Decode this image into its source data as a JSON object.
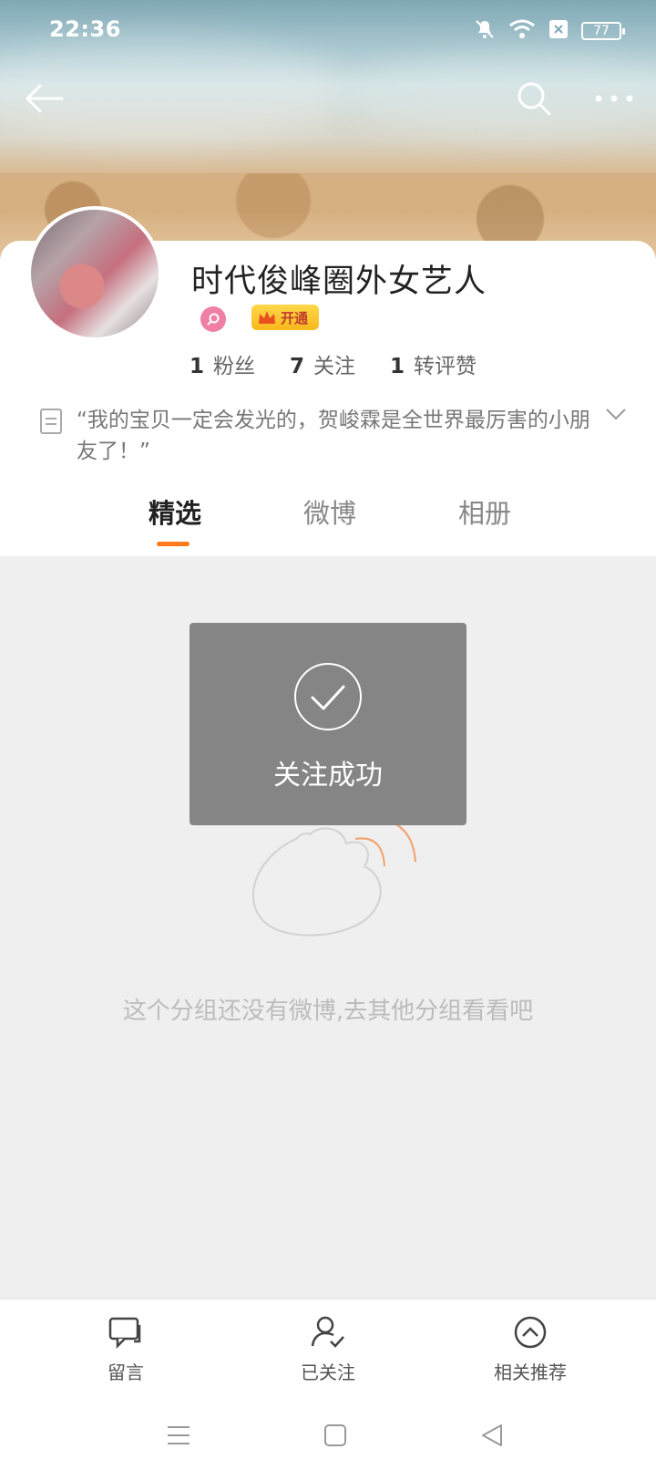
{
  "status_bar": {
    "time": "22:36",
    "battery": "77"
  },
  "profile": {
    "name": "时代俊峰圈外女艺人",
    "vip_label": "开通",
    "stats": [
      {
        "count": "1",
        "label": "粉丝"
      },
      {
        "count": "7",
        "label": "关注"
      },
      {
        "count": "1",
        "label": "转评赞"
      }
    ],
    "bio": "“我的宝贝一定会发光的，贺峻霖是全世界最厉害的小朋友了！”"
  },
  "tabs": [
    {
      "label": "精选",
      "active": true
    },
    {
      "label": "微博",
      "active": false
    },
    {
      "label": "相册",
      "active": false
    }
  ],
  "empty_state": {
    "message": "这个分组还没有微博,去其他分组看看吧"
  },
  "toast": {
    "message": "关注成功"
  },
  "bottom_actions": [
    {
      "label": "留言",
      "icon": "message-icon"
    },
    {
      "label": "已关注",
      "icon": "user-followed-icon"
    },
    {
      "label": "相关推荐",
      "icon": "chevron-up-circle-icon"
    }
  ],
  "colors": {
    "accent": "#ff7a1a",
    "toast_bg": "#858585"
  }
}
